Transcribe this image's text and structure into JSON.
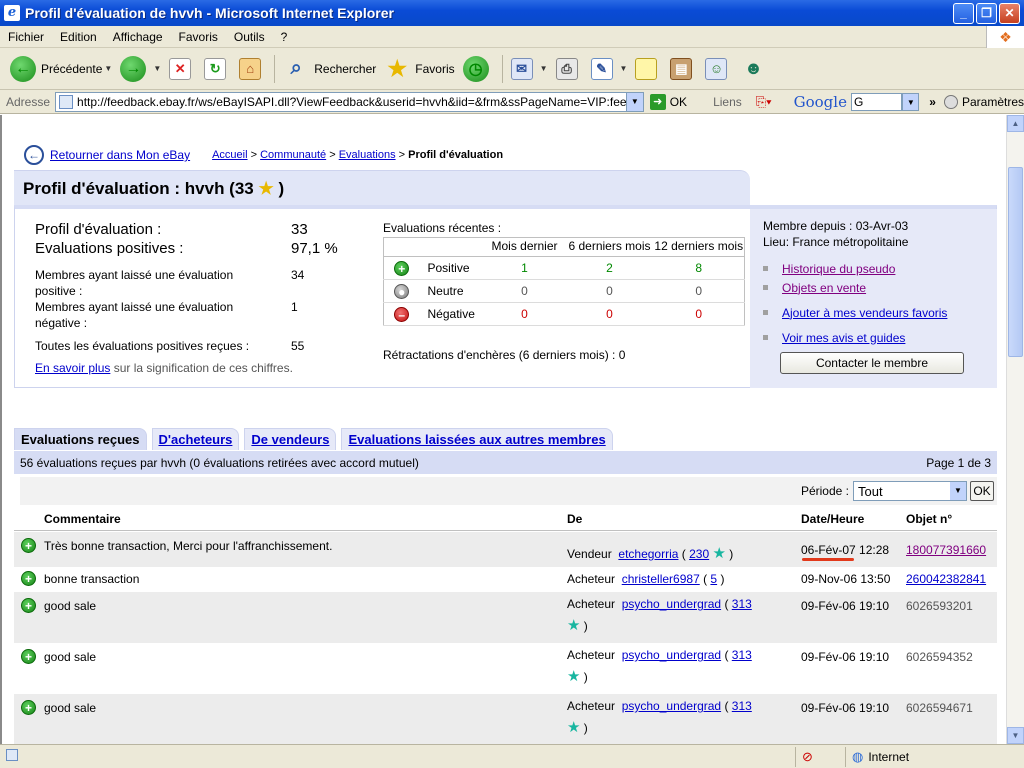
{
  "window": {
    "title": "Profil d'évaluation de hvvh - Microsoft Internet Explorer",
    "min": "_",
    "max": "❐",
    "close": "✕"
  },
  "menu": [
    "Fichier",
    "Edition",
    "Affichage",
    "Favoris",
    "Outils",
    "?"
  ],
  "toolbar": {
    "back": "Précédente",
    "search": "Rechercher",
    "favorites": "Favoris"
  },
  "address": {
    "label": "Adresse",
    "url": "http://feedback.ebay.fr/ws/eBayISAPI.dll?ViewFeedback&userid=hvvh&iid=&frm&ssPageName=VIP:feedback:1",
    "go": "OK",
    "links": "Liens",
    "google": "Google",
    "google_box": "G",
    "params": "Paramètres"
  },
  "page": {
    "back_link": "Retourner dans Mon eBay",
    "crumbs": {
      "home": "Accueil",
      "community": "Communauté",
      "evals": "Evaluations",
      "current": "Profil d'évaluation"
    },
    "heading": "Profil d'évaluation : hvvh (33",
    "heading_close": ")",
    "stats": {
      "profile_label": "Profil d'évaluation :",
      "profile_value": "33",
      "positive_label": "Evaluations positives :",
      "positive_value": "97,1 %",
      "members_pos_label": "Membres ayant laissé une évaluation positive :",
      "members_pos_value": "34",
      "members_neg_label": "Membres ayant laissé une évaluation négative :",
      "members_neg_value": "1",
      "all_pos_label": "Toutes les évaluations positives reçues :",
      "all_pos_value": "55",
      "learn_link": "En savoir plus",
      "learn_rest": " sur la signification de ces chiffres."
    },
    "recent": {
      "title": "Evaluations récentes :",
      "col1": "Mois dernier",
      "col2": "6 derniers mois",
      "col3": "12 derniers mois",
      "rows": [
        {
          "label": "Positive",
          "v1": "1",
          "v2": "2",
          "v3": "8"
        },
        {
          "label": "Neutre",
          "v1": "0",
          "v2": "0",
          "v3": "0"
        },
        {
          "label": "Négative",
          "v1": "0",
          "v2": "0",
          "v3": "0"
        }
      ],
      "retractions": "Rétractations d'enchères (6 derniers mois) : 0"
    },
    "member": {
      "since": "Membre depuis : 03-Avr-03",
      "location": "Lieu: France métropolitaine",
      "links": [
        "Historique du pseudo",
        "Objets en vente",
        "Ajouter à mes vendeurs favoris",
        "Voir mes avis et guides"
      ],
      "contact": "Contacter le membre"
    },
    "tabs": [
      "Evaluations reçues",
      "D'acheteurs",
      "De vendeurs",
      "Evaluations laissées aux autres membres"
    ],
    "summary": "56 évaluations reçues par hvvh (0 évaluations retirées avec accord mutuel)",
    "page_info": "Page 1 de 3",
    "period_label": "Période :",
    "period_value": "Tout",
    "period_ok": "OK",
    "table_headers": {
      "comment": "Commentaire",
      "from": "De",
      "date": "Date/Heure",
      "item": "Objet n°"
    },
    "rows": [
      {
        "comment": "Très bonne transaction, Merci pour l'affranchissement.",
        "role": "Vendeur",
        "user": "etchegorria",
        "score": "230",
        "date": "06-Fév-07 12:28",
        "item": "180077391660"
      },
      {
        "comment": "bonne transaction",
        "role": "Acheteur",
        "user": "christeller6987",
        "score": "5",
        "date": "09-Nov-06 13:50",
        "item": "260042382841"
      },
      {
        "comment": "good sale",
        "role": "Acheteur",
        "user": "psycho_undergrad",
        "score": "313",
        "date": "09-Fév-06 19:10",
        "item": "6026593201"
      },
      {
        "comment": "good sale",
        "role": "Acheteur",
        "user": "psycho_undergrad",
        "score": "313",
        "date": "09-Fév-06 19:10",
        "item": "6026594352"
      },
      {
        "comment": "good sale",
        "role": "Acheteur",
        "user": "psycho_undergrad",
        "score": "313",
        "date": "09-Fév-06 19:10",
        "item": "6026594671"
      }
    ]
  },
  "status": {
    "zone": "Internet"
  }
}
